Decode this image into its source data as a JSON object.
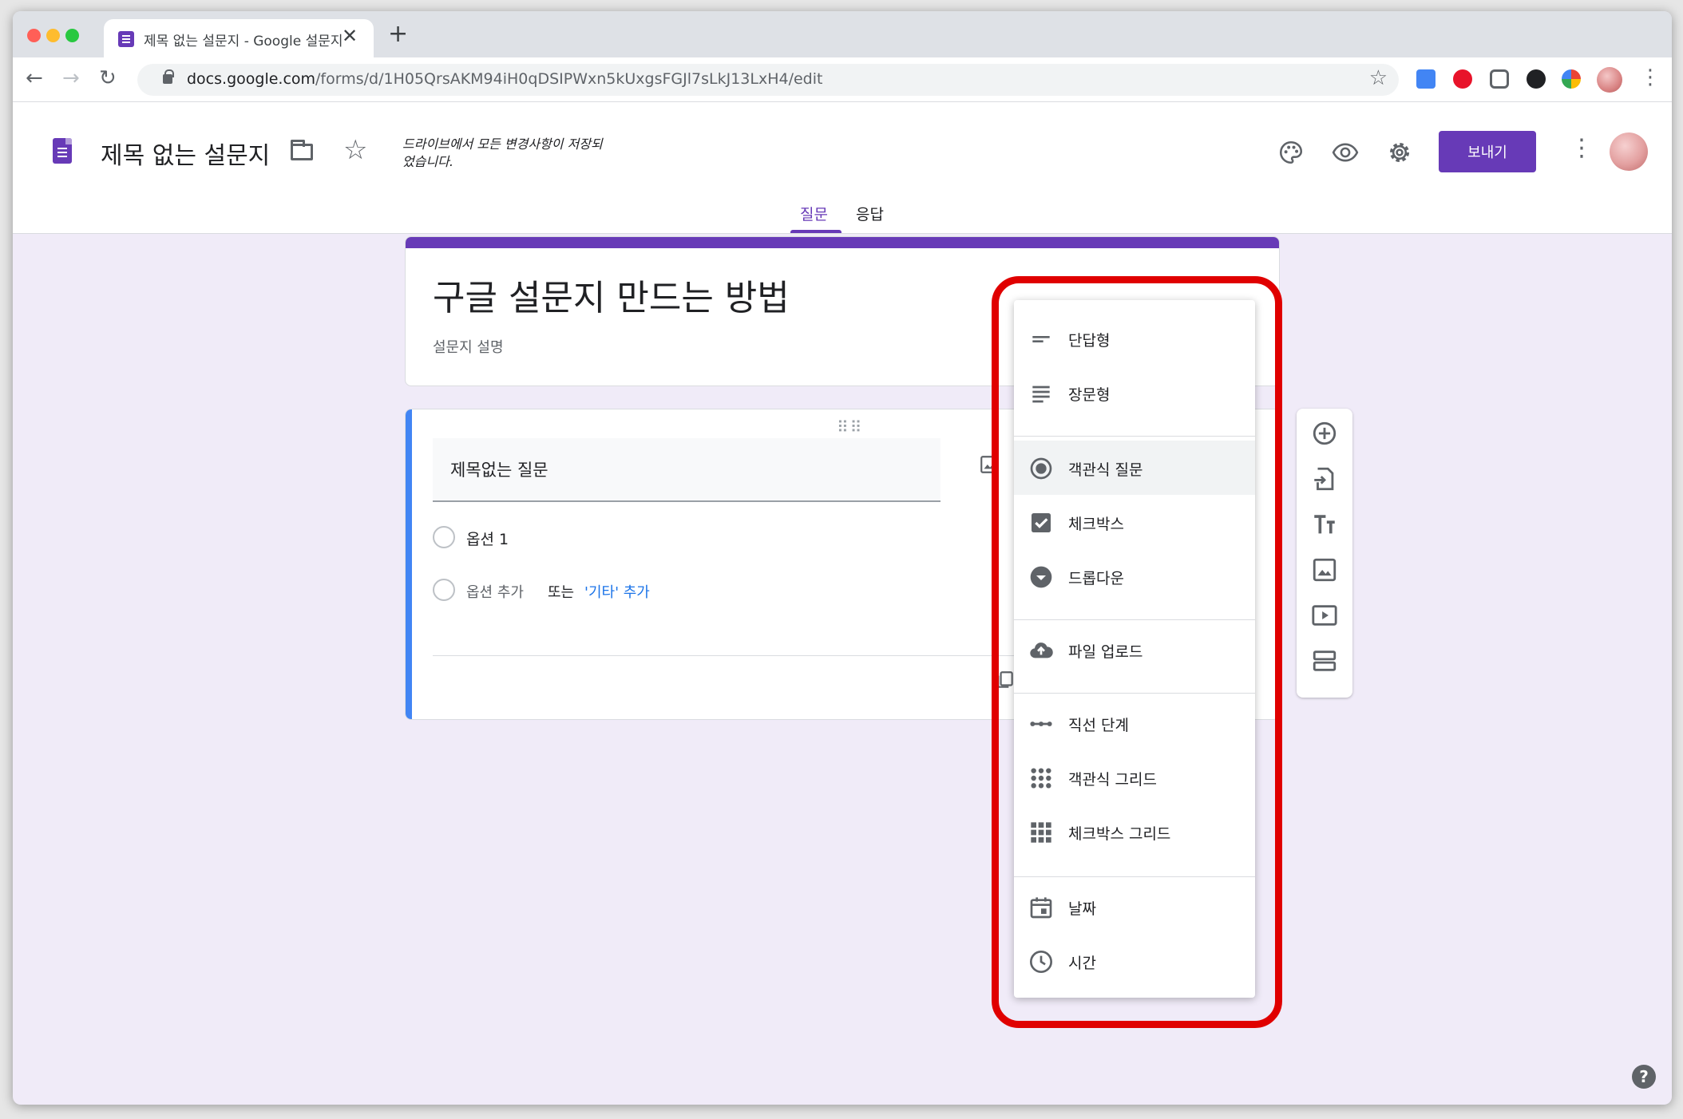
{
  "browser": {
    "tab_title": "제목 없는 설문지 - Google 설문지",
    "tab_close": "✕",
    "new_tab": "+",
    "url_host": "docs.google.com",
    "url_path": "/forms/d/1H05QrsAKM94iH0qDSIPWxn5kUxgsFGJl7sLkJ13LxH4/edit"
  },
  "header": {
    "doc_title": "제목 없는 설문지",
    "save_status": "드라이브에서 모든 변경사항이 저장되었습니다.",
    "send_label": "보내기"
  },
  "tabs": [
    {
      "label": "질문",
      "active": true
    },
    {
      "label": "응답",
      "active": false
    }
  ],
  "form": {
    "title": "구글 설문지 만드는 방법",
    "description": "설문지 설명"
  },
  "question": {
    "title": "제목없는 질문",
    "option1": "옵션 1",
    "add_option": "옵션 추가",
    "or": "또는",
    "add_other": "'기타' 추가"
  },
  "type_menu": {
    "items": [
      {
        "label": "단답형",
        "icon": "short-answer-icon"
      },
      {
        "label": "장문형",
        "icon": "paragraph-icon"
      },
      {
        "label": "객관식 질문",
        "icon": "radio-icon",
        "selected": true
      },
      {
        "label": "체크박스",
        "icon": "checkbox-icon"
      },
      {
        "label": "드롭다운",
        "icon": "dropdown-icon"
      },
      {
        "label": "파일 업로드",
        "icon": "cloud-upload-icon"
      },
      {
        "label": "직선 단계",
        "icon": "linear-scale-icon"
      },
      {
        "label": "객관식 그리드",
        "icon": "dot-grid-icon"
      },
      {
        "label": "체크박스 그리드",
        "icon": "square-grid-icon"
      },
      {
        "label": "날짜",
        "icon": "calendar-icon"
      },
      {
        "label": "시간",
        "icon": "clock-icon"
      }
    ]
  },
  "help": "?",
  "colors": {
    "accent": "#673ab7",
    "question_bar": "#4285f4",
    "highlight": "#e00000",
    "link": "#1a73e8"
  }
}
